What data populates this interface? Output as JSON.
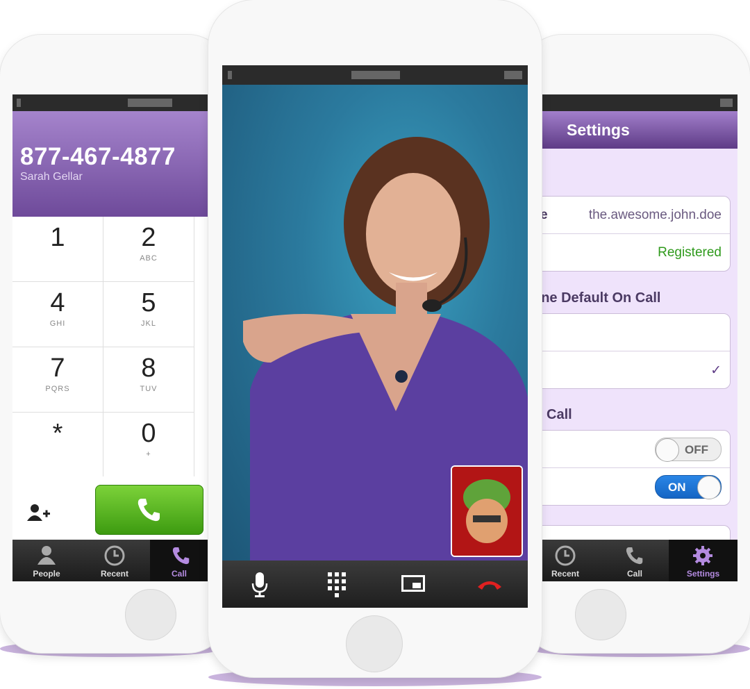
{
  "left_phone": {
    "dialed_number": "877-467-4877",
    "contact_name": "Sarah Gellar",
    "keys": [
      {
        "digit": "1",
        "letters": ""
      },
      {
        "digit": "2",
        "letters": "ABC"
      },
      {
        "digit": "4",
        "letters": "GHI"
      },
      {
        "digit": "5",
        "letters": "JKL"
      },
      {
        "digit": "7",
        "letters": "PQRS"
      },
      {
        "digit": "8",
        "letters": "TUV"
      },
      {
        "digit": "*",
        "letters": ""
      },
      {
        "digit": "0",
        "letters": "+"
      }
    ],
    "tabs": [
      {
        "label": "People",
        "icon": "person-icon"
      },
      {
        "label": "Recent",
        "icon": "clock-icon"
      },
      {
        "label": "Call",
        "icon": "phone-icon"
      }
    ],
    "active_tab": "Call",
    "call_button_color": "#4fb01c"
  },
  "center_phone": {
    "call_controls": [
      {
        "name": "mute",
        "icon": "microphone-icon"
      },
      {
        "name": "keypad",
        "icon": "keypad-icon"
      },
      {
        "name": "picture-in-picture",
        "icon": "pip-icon"
      },
      {
        "name": "end-call",
        "icon": "hang-up-icon"
      }
    ],
    "end_call_color": "#e02020"
  },
  "right_phone": {
    "title": "Settings",
    "account_row": {
      "label_fragment": "e",
      "value": "the.awesome.john.doe"
    },
    "status_row": {
      "value": "Registered",
      "color": "#2f9a1c"
    },
    "section_default_on_call": "one Default On Call",
    "section_call": "Call",
    "toggle_off_label": "OFF",
    "toggle_on_label": "ON",
    "checkmark": "✓",
    "tabs": [
      {
        "label": "Recent",
        "icon": "clock-icon"
      },
      {
        "label": "Call",
        "icon": "phone-icon"
      },
      {
        "label": "Settings",
        "icon": "gear-icon"
      }
    ],
    "active_tab": "Settings",
    "accent_color": "#7a52a8"
  }
}
